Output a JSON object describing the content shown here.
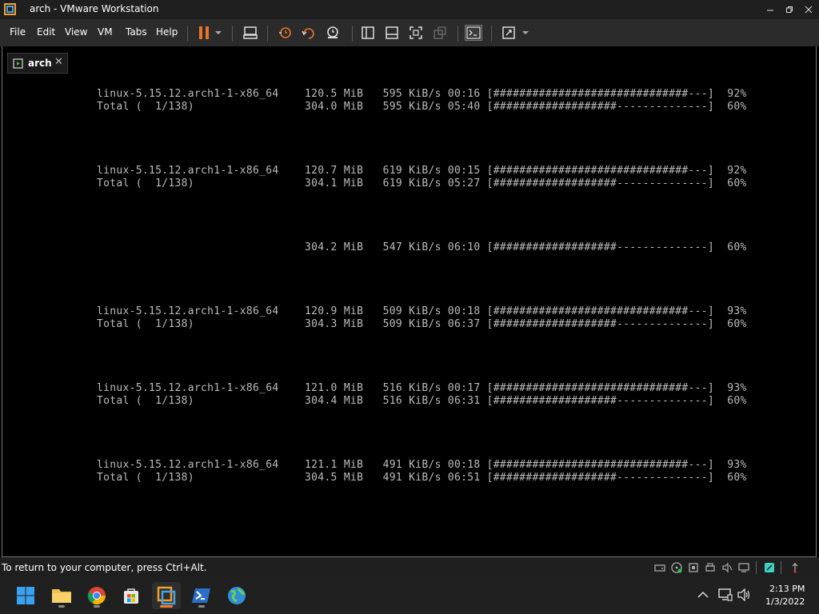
{
  "window": {
    "title": "arch - VMware Workstation"
  },
  "menu": {
    "items": [
      "File",
      "Edit",
      "View",
      "VM",
      "Tabs",
      "Help"
    ]
  },
  "tab": {
    "label": "arch",
    "close": "✕"
  },
  "console": {
    "lines": [
      "linux-5.15.12.arch1-1-x86_64    120.5 MiB   595 KiB/s 00:16 [##############################---]  92%",
      "Total (  1/138)                 304.0 MiB   595 KiB/s 05:40 [###################--------------]  60%",
      "linux-5.15.12.arch1-1-x86_64    120.7 MiB   619 KiB/s 00:15 [##############################---]  92%",
      "Total (  1/138)                 304.1 MiB   619 KiB/s 05:27 [###################--------------]  60%",
      "                                304.2 MiB   547 KiB/s 06:10 [###################--------------]  60%",
      "linux-5.15.12.arch1-1-x86_64    120.9 MiB   509 KiB/s 00:18 [##############################---]  93%",
      "Total (  1/138)                 304.3 MiB   509 KiB/s 06:37 [###################--------------]  60%",
      "linux-5.15.12.arch1-1-x86_64    121.0 MiB   516 KiB/s 00:17 [##############################---]  93%",
      "Total (  1/138)                 304.4 MiB   516 KiB/s 06:31 [###################--------------]  60%",
      "linux-5.15.12.arch1-1-x86_64    121.1 MiB   491 KiB/s 00:18 [##############################---]  93%",
      "Total (  1/138)                 304.5 MiB   491 KiB/s 06:51 [###################--------------]  60%"
    ]
  },
  "status": {
    "text": "To return to your computer, press Ctrl+Alt."
  },
  "taskbar": {
    "time": "2:13 PM",
    "date": "1/3/2022",
    "apps": [
      "start-icon",
      "file-explorer-icon",
      "chrome-icon",
      "store-icon",
      "vmware-icon",
      "powershell-icon",
      "network-globe-icon"
    ]
  },
  "colors": {
    "accent": "#ff7a2e",
    "terminal_text": "#bbbbbb",
    "pause": "#e8742a"
  }
}
